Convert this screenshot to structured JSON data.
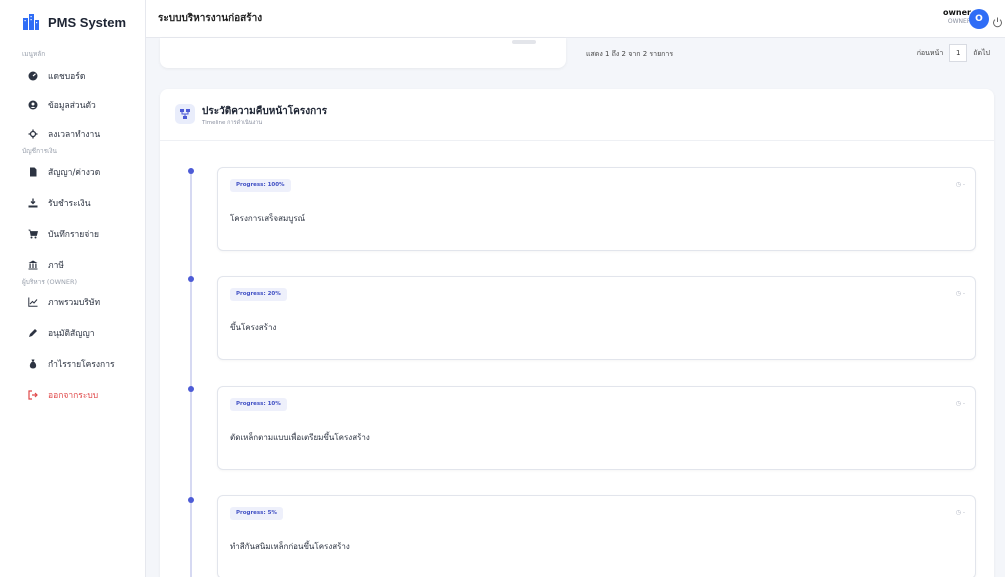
{
  "brand": {
    "name": "PMS System"
  },
  "header": {
    "title": "ระบบบริหารงานก่อสร้าง"
  },
  "user": {
    "name": "owner",
    "role": "OWNER",
    "initial": "O"
  },
  "sidebar": {
    "sections": [
      {
        "label": "เมนูหลัก",
        "items": [
          {
            "icon": "dashboard-icon",
            "label": "แดชบอร์ด"
          },
          {
            "icon": "user-icon",
            "label": "ข้อมูลส่วนตัว"
          },
          {
            "icon": "timesheet-icon",
            "label": "ลงเวลาทำงาน"
          }
        ]
      },
      {
        "label": "บัญชีการเงิน",
        "items": [
          {
            "icon": "document-icon",
            "label": "สัญญา/ค่างวด"
          },
          {
            "icon": "receive-money-icon",
            "label": "รับชำระเงิน"
          },
          {
            "icon": "cart-icon",
            "label": "บันทึกรายจ่าย"
          },
          {
            "icon": "bank-icon",
            "label": "ภาษี"
          }
        ]
      },
      {
        "label": "ผู้บริหาร (OWNER)",
        "items": [
          {
            "icon": "chart-icon",
            "label": "ภาพรวมบริษัท"
          },
          {
            "icon": "pen-icon",
            "label": "อนุมัติสัญญา"
          },
          {
            "icon": "money-bag-icon",
            "label": "กำไรรายโครงการ"
          }
        ]
      }
    ],
    "logout": {
      "icon": "logout-icon",
      "label": "ออกจากระบบ"
    }
  },
  "pagination": {
    "info": "แสดง 1 ถึง 2 จาก 2 รายการ",
    "prev": "ก่อนหน้า",
    "current": "1",
    "next": "ถัดไป"
  },
  "timeline": {
    "title": "ประวัติความคืบหน้าโครงการ",
    "subtitle": "Timeline การดำเนินงาน",
    "entries": [
      {
        "badge": "Progress: 100%",
        "progress": 100,
        "date": "◷ -",
        "text": "โครงการเสร็จสมบูรณ์"
      },
      {
        "badge": "Progress: 20%",
        "progress": 20,
        "date": "◷ -",
        "text": "ขึ้นโครงสร้าง"
      },
      {
        "badge": "Progress: 10%",
        "progress": 10,
        "date": "◷ -",
        "text": "ตัดเหล็กตามแบบเพื่อเตรียมขึ้นโครงสร้าง"
      },
      {
        "badge": "Progress: 5%",
        "progress": 5,
        "date": "◷ -",
        "text": "ทำสีกันสนิมเหล็กก่อนขึ้นโครงสร้าง"
      }
    ]
  },
  "colors": {
    "accent": "#2f6df6",
    "timeline": "#4d5bd6",
    "logout": "#e0494a",
    "badge_text": "#4150c4"
  }
}
